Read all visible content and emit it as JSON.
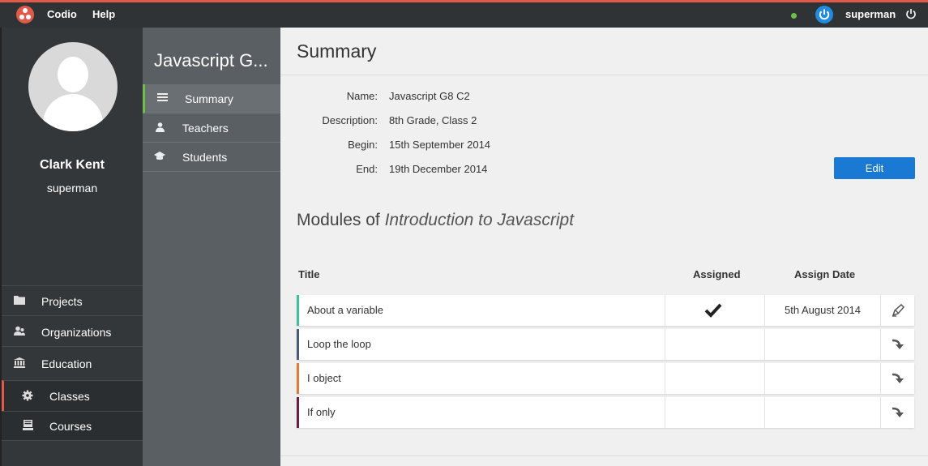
{
  "topbar": {
    "brand": "Codio",
    "help": "Help",
    "username": "superman",
    "status_color": "#6cc04a",
    "accent_color": "#e05a48"
  },
  "user": {
    "full_name": "Clark Kent",
    "handle": "superman"
  },
  "sidebar": {
    "items": [
      {
        "label": "Projects",
        "icon": "folder-icon"
      },
      {
        "label": "Organizations",
        "icon": "organization-icon"
      },
      {
        "label": "Education",
        "icon": "institution-icon"
      },
      {
        "label": "Classes",
        "icon": "gear-icon"
      },
      {
        "label": "Courses",
        "icon": "book-icon"
      }
    ]
  },
  "class_nav": {
    "title": "Javascript G...",
    "items": [
      {
        "label": "Summary",
        "icon": "list-icon"
      },
      {
        "label": "Teachers",
        "icon": "teacher-icon"
      },
      {
        "label": "Students",
        "icon": "graduation-cap-icon"
      }
    ]
  },
  "summary": {
    "page_title": "Summary",
    "fields": [
      {
        "label": "Name:",
        "value": "Javascript G8 C2"
      },
      {
        "label": "Description:",
        "value": "8th Grade, Class 2"
      },
      {
        "label": "Begin:",
        "value": "15th September 2014"
      },
      {
        "label": "End:",
        "value": "19th December 2014"
      }
    ],
    "edit_label": "Edit"
  },
  "modules": {
    "heading_prefix": "Modules of",
    "course_name": "Introduction to Javascript",
    "columns": {
      "title": "Title",
      "assigned": "Assigned",
      "assign_date": "Assign Date"
    },
    "rows": [
      {
        "title": "About a variable",
        "assigned": true,
        "assign_date": "5th August 2014",
        "action_icon": "edit-icon",
        "accent": "#3fbf9b"
      },
      {
        "title": "Loop the loop",
        "assigned": false,
        "assign_date": "",
        "action_icon": "assign-arrow-icon",
        "accent": "#4a5a78"
      },
      {
        "title": "I object",
        "assigned": false,
        "assign_date": "",
        "action_icon": "assign-arrow-icon",
        "accent": "#e07a3a"
      },
      {
        "title": "If only",
        "assigned": false,
        "assign_date": "",
        "action_icon": "assign-arrow-icon",
        "accent": "#6a1f3f"
      }
    ]
  }
}
